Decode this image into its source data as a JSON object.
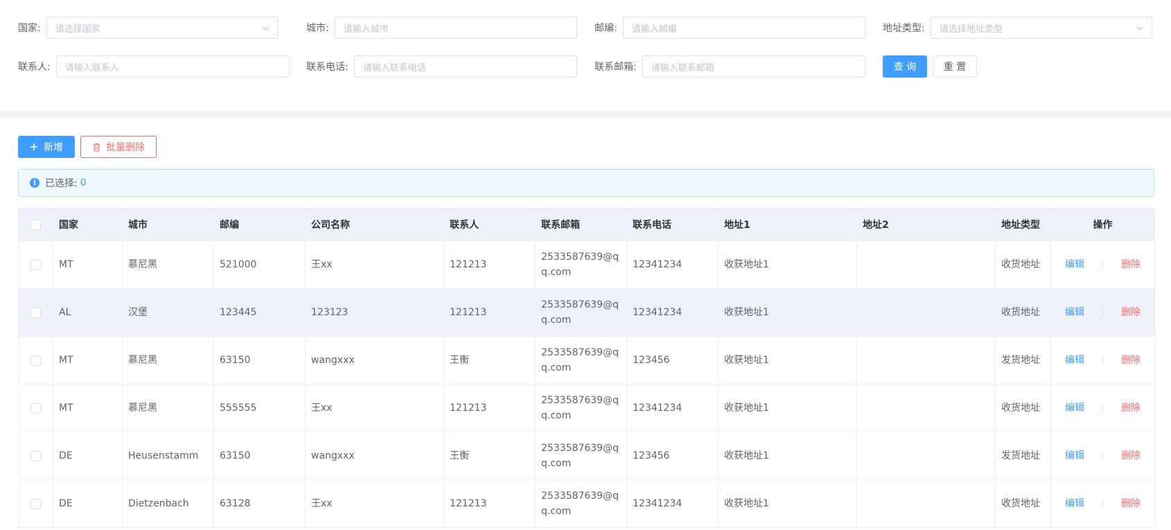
{
  "search": {
    "country": {
      "label": "国家:",
      "placeholder": "请选择国家"
    },
    "city": {
      "label": "城市:",
      "placeholder": "请输入城市"
    },
    "zip": {
      "label": "邮编:",
      "placeholder": "请输入邮编"
    },
    "address_type": {
      "label": "地址类型:",
      "placeholder": "请选择地址类型"
    },
    "contact": {
      "label": "联系人:",
      "placeholder": "请输入联系人"
    },
    "phone": {
      "label": "联系电话:",
      "placeholder": "请输入联系电话"
    },
    "email": {
      "label": "联系邮箱:",
      "placeholder": "请输入联系邮箱"
    },
    "query_label": "查 询",
    "reset_label": "重 置"
  },
  "toolbar": {
    "add_label": "新增",
    "batch_delete_label": "批量删除"
  },
  "selection": {
    "label": "已选择:",
    "count": "0"
  },
  "table": {
    "headers": {
      "country": "国家",
      "city": "城市",
      "zip": "邮编",
      "company": "公司名称",
      "contact": "联系人",
      "email": "联系邮箱",
      "phone": "联系电话",
      "address1": "地址1",
      "address2": "地址2",
      "address_type": "地址类型",
      "actions": "操作"
    },
    "edit_label": "编辑",
    "delete_label": "删除",
    "rows": [
      {
        "country": "MT",
        "city": "慕尼黑",
        "zip": "521000",
        "company": "王xx",
        "contact": "121213",
        "email": "2533587639@qq.com",
        "phone": "12341234",
        "address1": "收获地址1",
        "address2": "",
        "address_type": "收货地址"
      },
      {
        "country": "AL",
        "city": "汉堡",
        "zip": "123445",
        "company": "123123",
        "contact": "121213",
        "email": "2533587639@qq.com",
        "phone": "12341234",
        "address1": "收获地址1",
        "address2": "",
        "address_type": "收货地址"
      },
      {
        "country": "MT",
        "city": "慕尼黑",
        "zip": "63150",
        "company": "wangxxx",
        "contact": "王衡",
        "email": "2533587639@qq.com",
        "phone": "123456",
        "address1": "收获地址1",
        "address2": "",
        "address_type": "发货地址"
      },
      {
        "country": "MT",
        "city": "慕尼黑",
        "zip": "555555",
        "company": "王xx",
        "contact": "121213",
        "email": "2533587639@qq.com",
        "phone": "12341234",
        "address1": "收获地址1",
        "address2": "",
        "address_type": "收货地址"
      },
      {
        "country": "DE",
        "city": "Heusenstamm",
        "zip": "63150",
        "company": "wangxxx",
        "contact": "王衡",
        "email": "2533587639@qq.com",
        "phone": "123456",
        "address1": "收获地址1",
        "address2": "",
        "address_type": "发货地址"
      },
      {
        "country": "DE",
        "city": "Dietzenbach",
        "zip": "63128",
        "company": "王xx",
        "contact": "121213",
        "email": "2533587639@qq.com",
        "phone": "12341234",
        "address1": "收获地址1",
        "address2": "",
        "address_type": "收货地址"
      }
    ]
  },
  "colors": {
    "primary": "#409eff",
    "danger": "#f56c6c",
    "header_bg": "#eef2f8",
    "info_bg": "#f0f8ff"
  }
}
